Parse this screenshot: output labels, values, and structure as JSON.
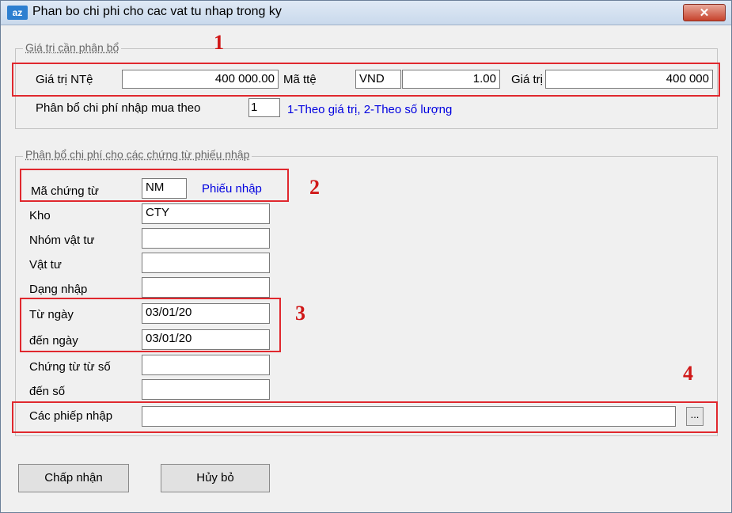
{
  "window": {
    "app_icon": "az",
    "title": "Phan bo chi phi cho cac vat tu nhap trong ky",
    "close_glyph": "✕"
  },
  "group1": {
    "legend": "Giá trị cần phân bổ",
    "gia_tri_nte_label": "Giá trị NTệ",
    "gia_tri_nte_value": "400 000.00",
    "ma_tte_label": "Mã ttệ",
    "ma_tte_value": "VND",
    "ty_gia_value": "1.00",
    "gia_tri_label": "Giá trị",
    "gia_tri_value": "400 000",
    "phan_bo_label": "Phân bổ chi phí nhập mua theo",
    "phan_bo_value": "1",
    "phan_bo_hint": "1-Theo giá trị,  2-Theo số lượng"
  },
  "group2": {
    "legend": "Phân bổ chi phí cho các chứng từ phiếu nhập",
    "ma_chung_tu_label": "Mã chứng từ",
    "ma_chung_tu_value": "NM",
    "ma_chung_tu_name": "Phiếu nhập",
    "kho_label": "Kho",
    "kho_value": "CTY",
    "nhom_vat_tu_label": "Nhóm vật tư",
    "nhom_vat_tu_value": "",
    "vat_tu_label": "Vật tư",
    "vat_tu_value": "",
    "dang_nhap_label": "Dạng nhập",
    "dang_nhap_value": "",
    "tu_ngay_label": "Từ ngày",
    "tu_ngay_value": "03/01/20",
    "den_ngay_label": "đến ngày",
    "den_ngay_value": "03/01/20",
    "ct_tu_so_label": "Chứng từ từ số",
    "ct_tu_so_value": "",
    "den_so_label": "đến số",
    "den_so_value": "",
    "cac_phieu_nhap_label": "Các phiếp nhập",
    "cac_phieu_nhap_value": "",
    "browse_label": "..."
  },
  "annotations": {
    "n1": "1",
    "n2": "2",
    "n3": "3",
    "n4": "4",
    "color": "#e0282e"
  },
  "buttons": {
    "accept": "Chấp nhận",
    "cancel": "Hủy bỏ"
  }
}
